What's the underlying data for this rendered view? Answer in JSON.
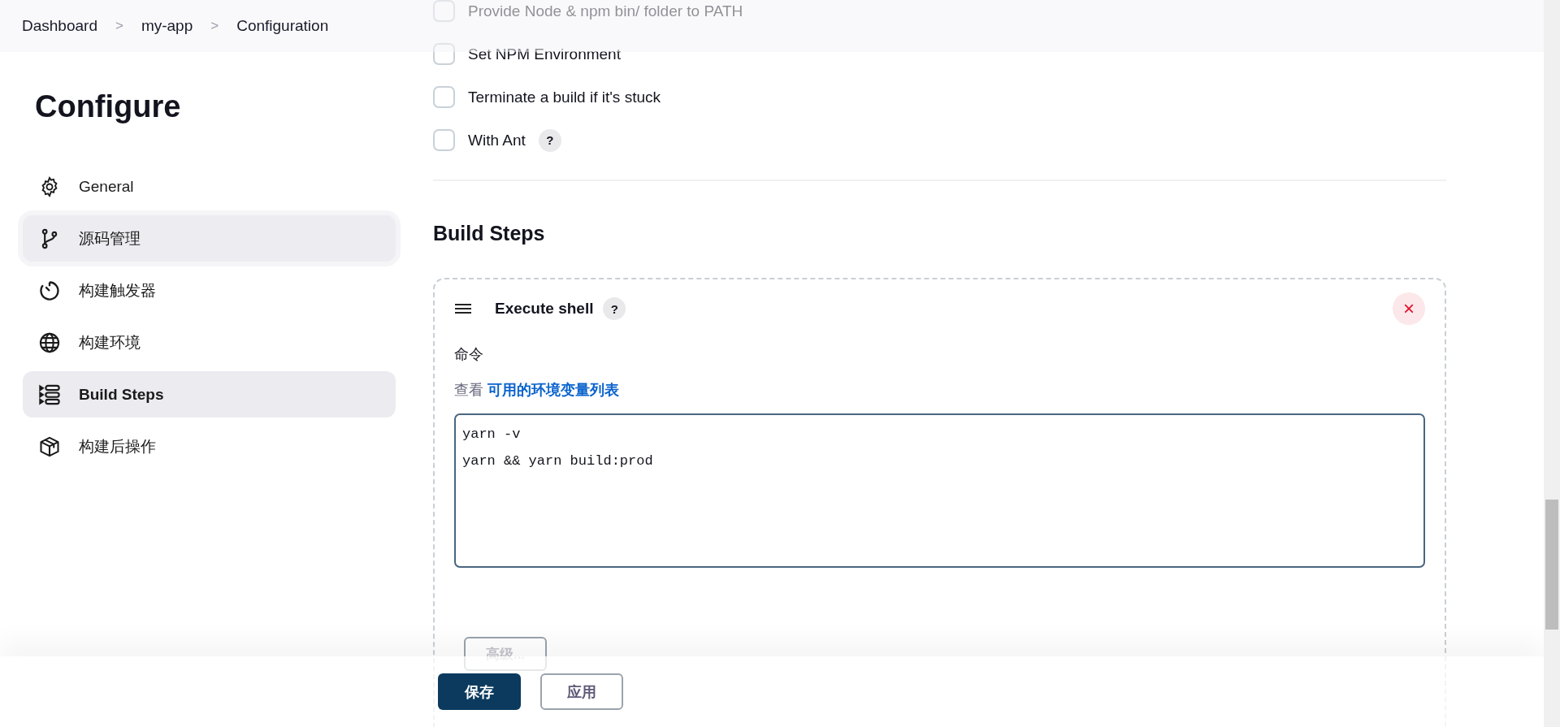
{
  "breadcrumbs": [
    {
      "label": "Dashboard",
      "separator": ">"
    },
    {
      "label": "my-app",
      "separator": ">"
    },
    {
      "label": "Configuration"
    }
  ],
  "sidebar": {
    "title": "Configure",
    "items": [
      {
        "label": "General",
        "selected": false,
        "focused": false
      },
      {
        "label": "源码管理",
        "selected": false,
        "focused": true
      },
      {
        "label": "构建触发器",
        "selected": false,
        "focused": false
      },
      {
        "label": "构建环境",
        "selected": false,
        "focused": false
      },
      {
        "label": "Build Steps",
        "selected": true,
        "focused": false
      },
      {
        "label": "构建后操作",
        "selected": false,
        "focused": false
      }
    ]
  },
  "options": [
    {
      "label": "Provide Node & npm bin/ folder to PATH",
      "checked": false
    },
    {
      "label": "Set NPM Environment",
      "checked": false
    },
    {
      "label": "Terminate a build if it's stuck",
      "checked": false
    },
    {
      "label": "With Ant",
      "checked": false,
      "help": "?"
    }
  ],
  "section": {
    "title": "Build Steps"
  },
  "step": {
    "title": "Execute shell",
    "help": "?",
    "close": "×",
    "command_label": "命令",
    "hint": "查看",
    "hint_link": "可用的环境变量列表",
    "command_lines": [
      "yarn -v",
      "yarn && yarn build:prod"
    ],
    "advanced_button": "高级..."
  },
  "footer": {
    "buttons": [
      {
        "label": "保存",
        "kind": "primary"
      },
      {
        "label": "应用",
        "kind": "secondary"
      }
    ]
  }
}
